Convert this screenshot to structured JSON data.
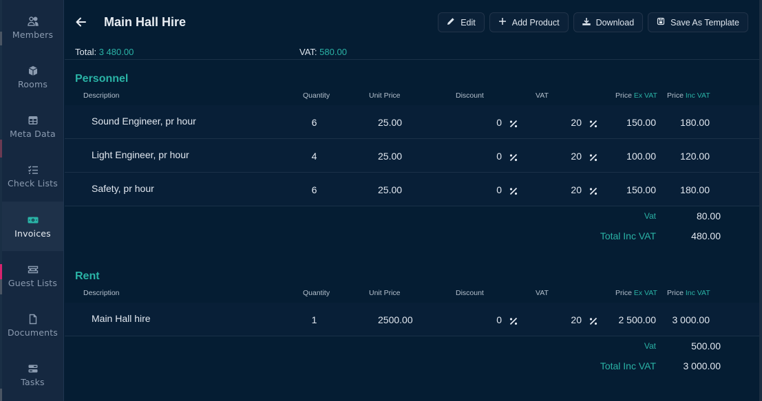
{
  "colors": {
    "accent": "#2ab3a6",
    "background": "#051d33",
    "sidebar": "#152840",
    "sidebar_active": "#1e3149",
    "row": "#081f37",
    "divider": "#1b3148"
  },
  "sidebar": {
    "items": [
      {
        "label": "Members",
        "icon": "members-icon",
        "active": false
      },
      {
        "label": "Rooms",
        "icon": "cube-icon",
        "active": false
      },
      {
        "label": "Meta Data",
        "icon": "table-icon",
        "active": false
      },
      {
        "label": "Check Lists",
        "icon": "checklist-icon",
        "active": false
      },
      {
        "label": "Invoices",
        "icon": "banknote-icon",
        "active": true
      },
      {
        "label": "Guest Lists",
        "icon": "ticket-icon",
        "active": false
      },
      {
        "label": "Documents",
        "icon": "document-icon",
        "active": false
      },
      {
        "label": "Tasks",
        "icon": "server-icon",
        "active": false
      }
    ]
  },
  "header": {
    "title": "Main Hall Hire",
    "buttons": [
      {
        "label": "Edit",
        "icon": "pencil-icon"
      },
      {
        "label": "Add Product",
        "icon": "plus-icon"
      },
      {
        "label": "Download",
        "icon": "download-icon"
      },
      {
        "label": "Save As Template",
        "icon": "save-icon"
      }
    ]
  },
  "summary": {
    "total_label": "Total:",
    "total_value": "3 480.00",
    "vat_label": "VAT:",
    "vat_value": "580.00"
  },
  "columns": {
    "description": "Description",
    "quantity": "Quantity",
    "unit_price": "Unit Price",
    "discount": "Discount",
    "vat": "VAT",
    "price_ex_prefix": "Price",
    "price_ex_accent": "Ex VAT",
    "price_inc_prefix": "Price",
    "price_inc_accent": "Inc VAT"
  },
  "sections": [
    {
      "title": "Personnel",
      "rows": [
        {
          "description": "Sound Engineer, pr hour",
          "quantity": "6",
          "unit_price": "25.00",
          "discount": "0",
          "vat": "20",
          "price_ex": "150.00",
          "price_inc": "180.00"
        },
        {
          "description": "Light Engineer, pr hour",
          "quantity": "4",
          "unit_price": "25.00",
          "discount": "0",
          "vat": "20",
          "price_ex": "100.00",
          "price_inc": "120.00"
        },
        {
          "description": "Safety, pr hour",
          "quantity": "6",
          "unit_price": "25.00",
          "discount": "0",
          "vat": "20",
          "price_ex": "150.00",
          "price_inc": "180.00"
        }
      ],
      "vat_label": "Vat",
      "vat_value": "80.00",
      "total_label": "Total Inc VAT",
      "total_value": "480.00"
    },
    {
      "title": "Rent",
      "rows": [
        {
          "description": "Main Hall hire",
          "quantity": "1",
          "unit_price": "2500.00",
          "discount": "0",
          "vat": "20",
          "price_ex": "2 500.00",
          "price_inc": "3 000.00"
        }
      ],
      "vat_label": "Vat",
      "vat_value": "500.00",
      "total_label": "Total Inc VAT",
      "total_value": "3 000.00"
    }
  ],
  "unit_symbol": "%"
}
